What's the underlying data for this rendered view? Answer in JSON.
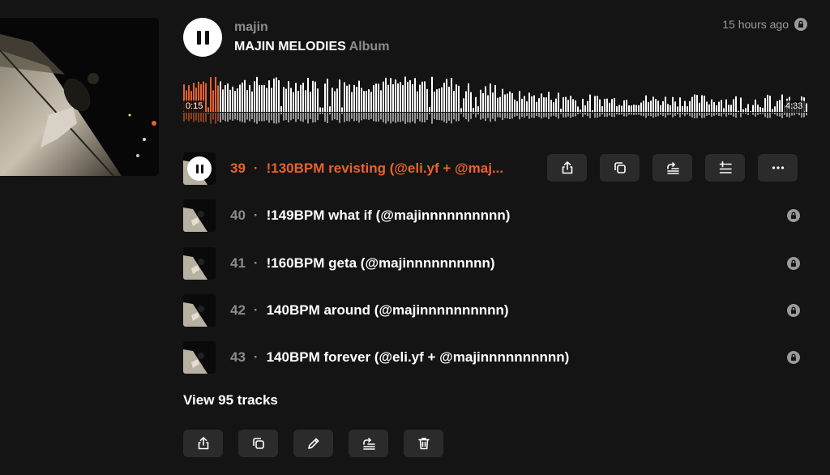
{
  "header": {
    "artist": "majin",
    "title": "MAJIN MELODIES",
    "kind": "Album",
    "timestamp": "15 hours ago",
    "icons": {
      "play": "pause-icon",
      "privacy": "lock-icon"
    }
  },
  "waveform": {
    "current_time": "0:15",
    "duration": "4:33",
    "progress_fraction": 0.055,
    "played_color": "#e8622e",
    "unplayed_color": "#ffffff"
  },
  "tracks": [
    {
      "number": "39",
      "title": "!130BPM revisting (@eli.yf + @maj...",
      "active": true
    },
    {
      "number": "40",
      "title": "!149BPM what if (@majinnnnnnnnnn)",
      "active": false
    },
    {
      "number": "41",
      "title": "!160BPM geta (@majinnnnnnnnnn)",
      "active": false
    },
    {
      "number": "42",
      "title": "140BPM around (@majinnnnnnnnnn)",
      "active": false
    },
    {
      "number": "43",
      "title": "140BPM forever (@eli.yf + @majinnnnnnnnnn)",
      "active": false
    }
  ],
  "separator": "·",
  "view_all": "View 95 tracks",
  "row_actions": [
    "share-icon",
    "copy-icon",
    "add-to-queue-icon",
    "play-next-icon",
    "more-icon"
  ],
  "bottom_actions": [
    "share-icon",
    "copy-icon",
    "edit-icon",
    "add-to-queue-icon",
    "delete-icon"
  ],
  "colors": {
    "accent": "#e8622e",
    "background": "#141414",
    "button": "#2b2b2b",
    "muted": "#8c8c8c"
  }
}
